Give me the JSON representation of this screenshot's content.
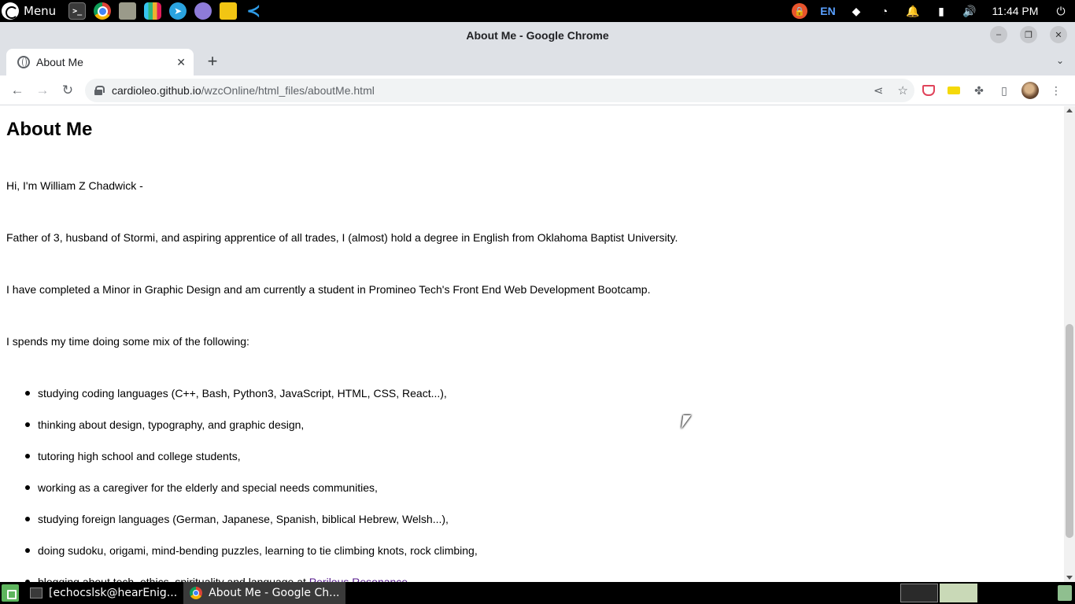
{
  "os_panel": {
    "menu_label": "Menu",
    "launchers": [
      "terminal-icon",
      "chrome-icon",
      "files-icon",
      "slack-icon",
      "telegram-icon",
      "purple-app-icon",
      "yellow-app-icon",
      "vscode-icon"
    ],
    "tray": {
      "language": "EN",
      "clock": "11:44 PM"
    }
  },
  "window": {
    "title": "About Me - Google Chrome"
  },
  "tabs": [
    {
      "title": "About Me",
      "active": true
    }
  ],
  "toolbar": {
    "url_host": "cardioleo.github.io",
    "url_path": "/wzcOnline/html_files/aboutMe.html"
  },
  "page": {
    "heading": "About Me",
    "intro": "Hi, I'm William Z Chadwick -",
    "para_family": "Father of 3, husband of Stormi, and aspiring apprentice of all trades, I (almost) hold a degree in English from Oklahoma Baptist University.",
    "para_education": "I have completed a Minor in Graphic Design and am currently a student in Promineo Tech's Front End Web Development Bootcamp.",
    "para_time": "I spends my time doing some mix of the following:",
    "list": [
      "studying coding languages (C++, Bash, Python3, JavaScript, HTML, CSS, React...),",
      "thinking about design, typography, and graphic design,",
      "tutoring high school and college students,",
      "working as a caregiver for the elderly and special needs communities,",
      "studying foreign languages (German, Japanese, Spanish, biblical Hebrew, Welsh...),",
      "doing sudoku, origami, mind-bending puzzles, learning to tie climbing knots, rock climbing,"
    ],
    "last_item_text": "blogging about tech, ethics, spirituality and language at ",
    "last_item_link": "Perilous Resonance"
  },
  "taskbar": {
    "tasks": [
      {
        "label": "[echocslsk@hearEnig...",
        "active": false
      },
      {
        "label": "About Me - Google Ch...",
        "active": true
      }
    ]
  },
  "colors": {
    "link_visited": "#551a8b",
    "chrome_frame": "#dee1e6"
  }
}
